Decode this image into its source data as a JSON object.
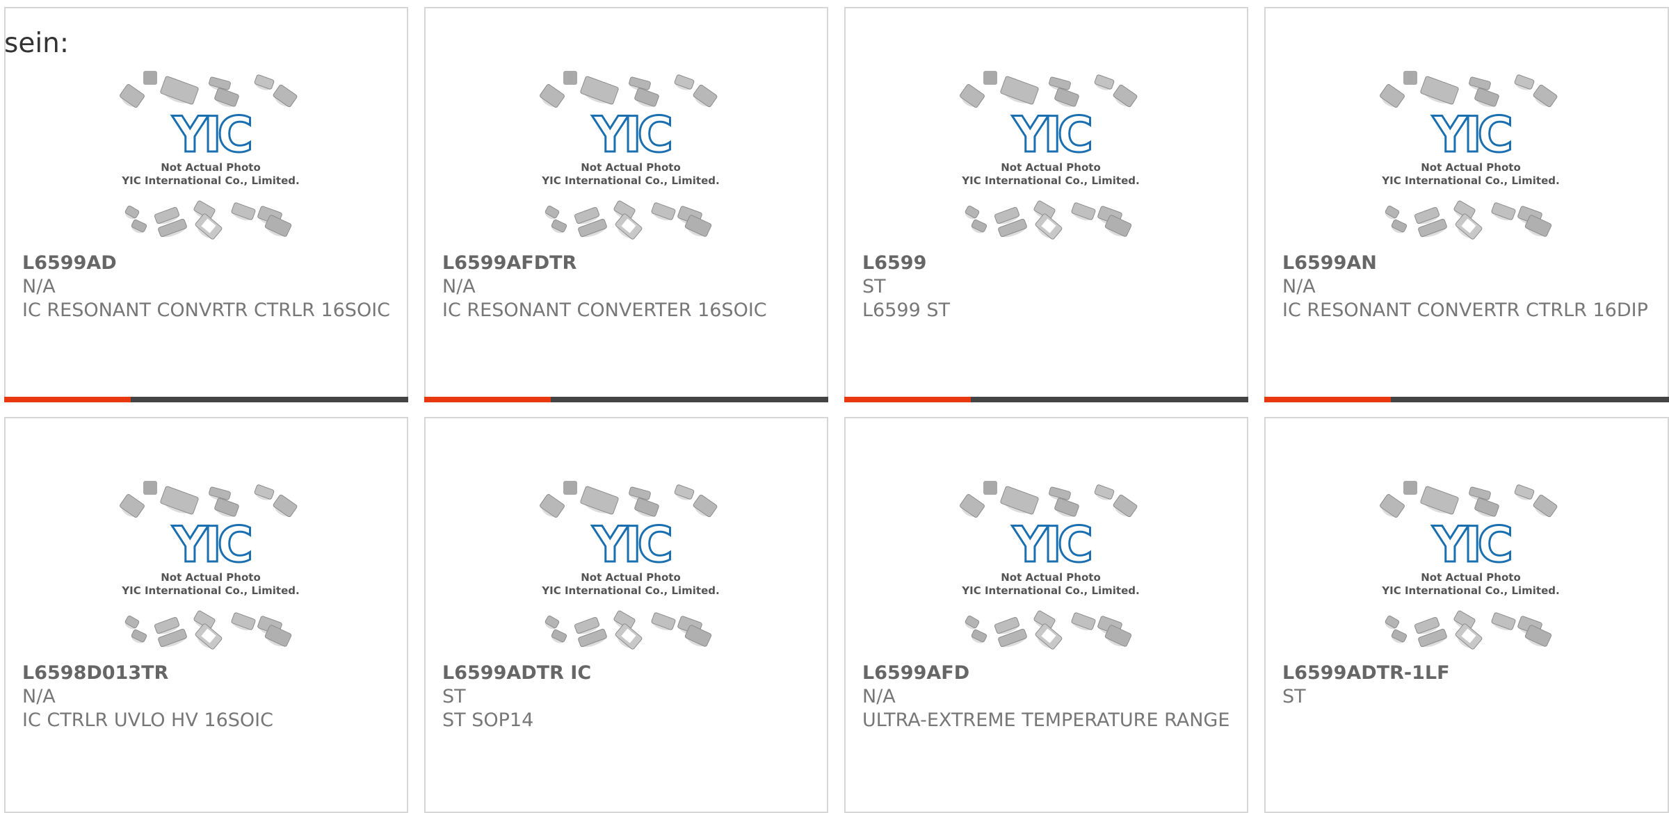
{
  "intro_text": "sein:",
  "colors": {
    "accent": "#e8380d",
    "bar_dark": "#444444",
    "logo_blue": "#1a6fb0"
  },
  "placeholder": {
    "caption_line1": "Not Actual Photo",
    "caption_line2": "YIC International Co., Limited.",
    "logo_text": "YIC"
  },
  "products": [
    {
      "part": "L6599AD",
      "mfr": "N/A",
      "desc": "IC RESONANT CONVRTR CTRLR 16SOIC"
    },
    {
      "part": "L6599AFDTR",
      "mfr": "N/A",
      "desc": "IC RESONANT CONVERTER 16SOIC"
    },
    {
      "part": "L6599",
      "mfr": "ST",
      "desc": "L6599 ST"
    },
    {
      "part": "L6599AN",
      "mfr": "N/A",
      "desc": "IC RESONANT CONVERTR CTRLR 16DIP"
    },
    {
      "part": "L6598D013TR",
      "mfr": "N/A",
      "desc": "IC CTRLR UVLO HV 16SOIC"
    },
    {
      "part": "L6599ADTR IC",
      "mfr": "ST",
      "desc": "ST SOP14"
    },
    {
      "part": "L6599AFD",
      "mfr": "N/A",
      "desc": "ULTRA-EXTREME TEMPERATURE RANGE"
    },
    {
      "part": "L6599ADTR-1LF",
      "mfr": "ST",
      "desc": ""
    }
  ]
}
